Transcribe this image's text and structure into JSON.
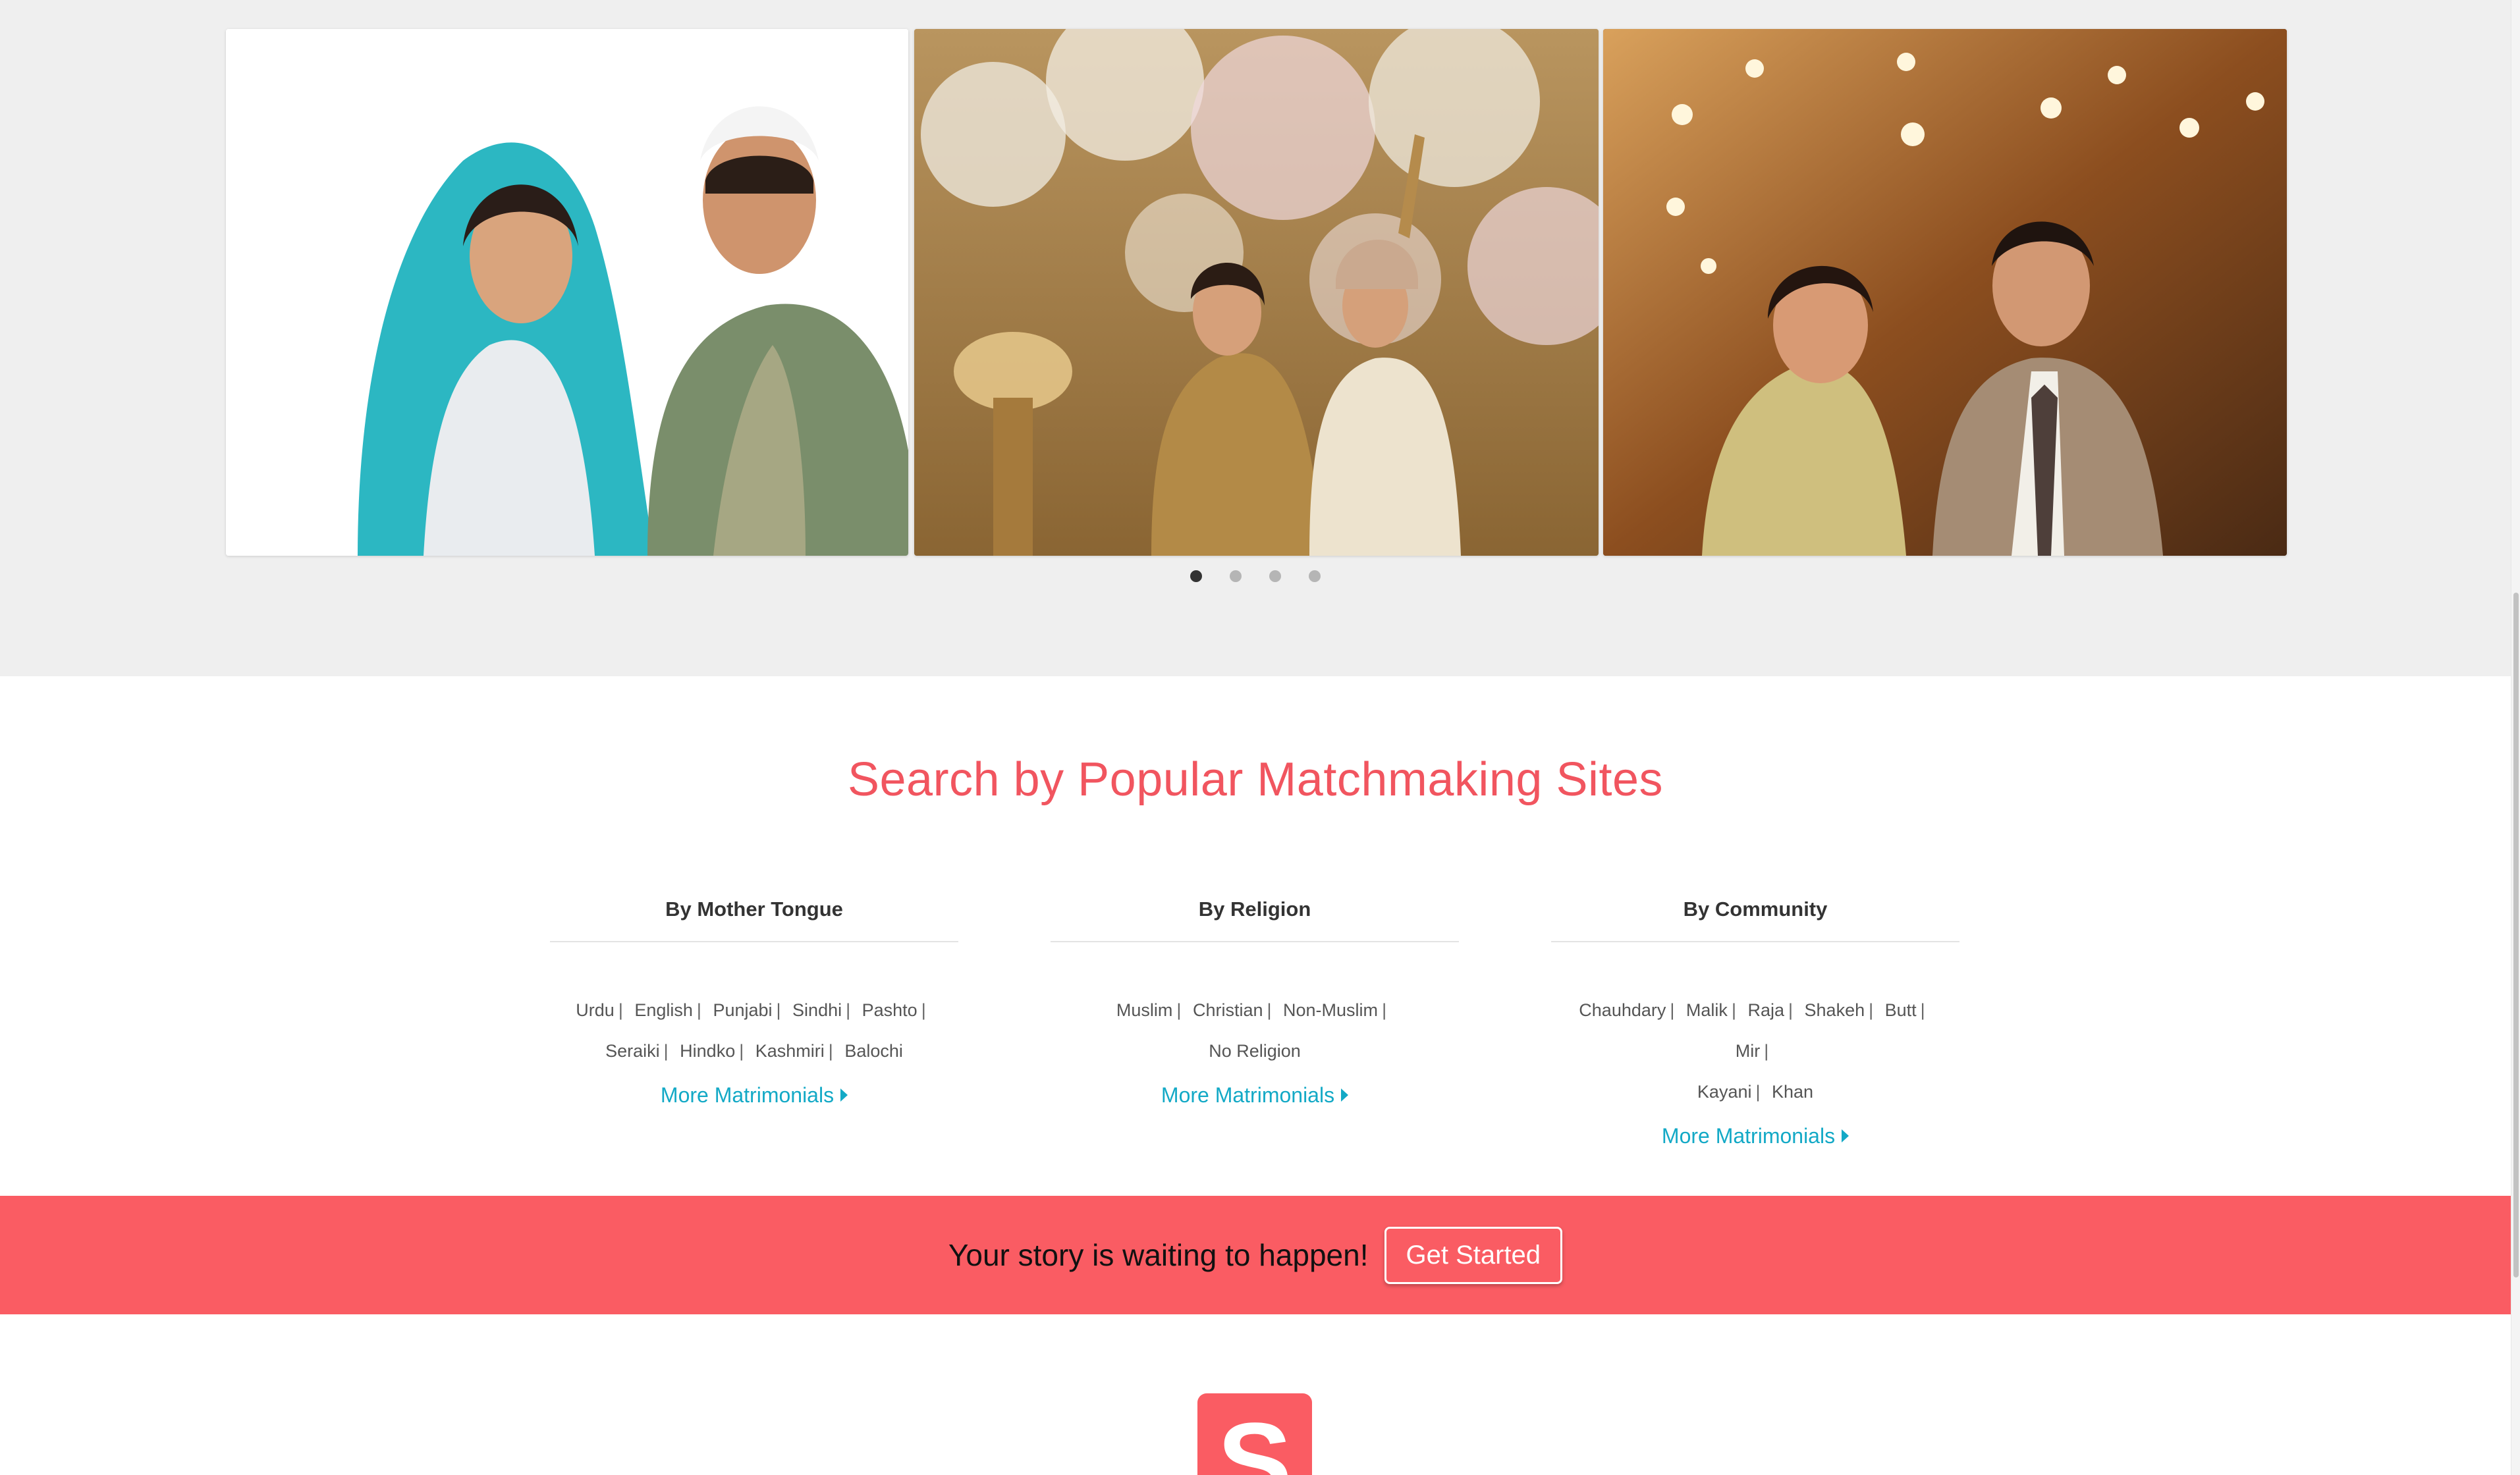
{
  "carousel": {
    "slides": [
      {
        "alt": "couple-photo-1"
      },
      {
        "alt": "couple-photo-2"
      },
      {
        "alt": "couple-photo-3"
      }
    ],
    "dot_count": 4,
    "active_index": 0
  },
  "search_section": {
    "title": "Search by Popular Matchmaking Sites",
    "columns": [
      {
        "heading": "By Mother Tongue",
        "links": [
          "Urdu",
          "English",
          "Punjabi",
          "Sindhi",
          "Pashto",
          "Seraiki",
          "Hindko",
          "Kashmiri",
          "Balochi"
        ],
        "more_label": "More Matrimonials"
      },
      {
        "heading": "By Religion",
        "links": [
          "Muslim",
          "Christian",
          "Non-Muslim",
          "No Religion"
        ],
        "more_label": "More Matrimonials"
      },
      {
        "heading": "By Community",
        "links": [
          "Chauhdary",
          "Malik",
          "Raja",
          "Shakeh",
          "Butt",
          "Mir",
          "Kayani",
          "Khan"
        ],
        "more_label": "More Matrimonials"
      }
    ]
  },
  "cta": {
    "text": "Your story is waiting to happen!",
    "button_label": "Get Started"
  },
  "footer": {
    "logo_letter": "S"
  },
  "colors": {
    "accent": "#fa5c63",
    "title": "#f1555f",
    "link": "#13a9c6",
    "band": "#efefef"
  }
}
